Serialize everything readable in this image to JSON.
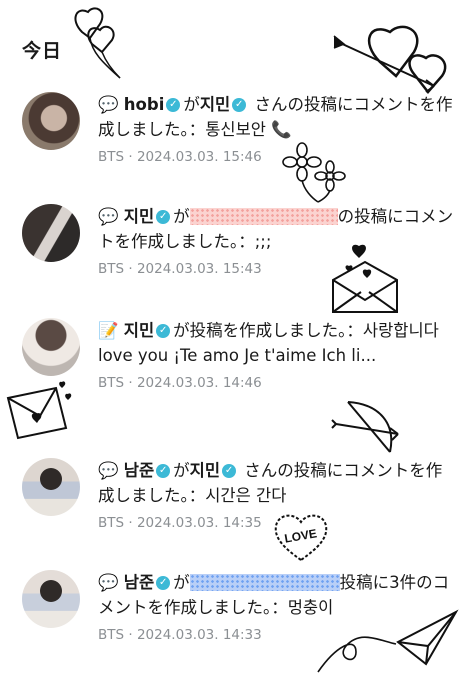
{
  "header": {
    "title": "今日"
  },
  "notifications": [
    {
      "icon": "💬",
      "name": "hobi",
      "text_a": "が",
      "text_name2": "지민",
      "text_b": "さんの投稿にコメントを作成しました。：통신보안",
      "emoji": "📞",
      "meta": "BTS · 2024.03.03. 15:46"
    },
    {
      "icon": "💬",
      "name": "지민",
      "text_a": "が",
      "text_b": "の投稿にコメントを作成しました。：;;;",
      "meta": "BTS · 2024.03.03. 15:43"
    },
    {
      "icon": "📝",
      "name": "지민",
      "text_a": "が投稿を作成しました。：사랑합니다",
      "text_b": "love you ¡Te amo Je t'aime Ich li...",
      "meta": "BTS · 2024.03.03. 14:46"
    },
    {
      "icon": "💬",
      "name": "남준",
      "text_a": "が",
      "text_name2": "지민",
      "text_b": "さんの投稿にコメントを作成しました。：시간은 간다",
      "meta": "BTS · 2024.03.03. 14:35"
    },
    {
      "icon": "💬",
      "name": "남준",
      "text_a": "が",
      "text_b": "投稿に3件のコメントを作成しました。：멍충이",
      "meta": "BTS · 2024.03.03. 14:33"
    }
  ],
  "stickers": {
    "love_label": "LOVE"
  },
  "colors": {
    "verified": "#3cb9d6",
    "meta_text": "#8b8f93",
    "redact_pink": "#f3a19d",
    "redact_blue": "#6fa1f1"
  }
}
